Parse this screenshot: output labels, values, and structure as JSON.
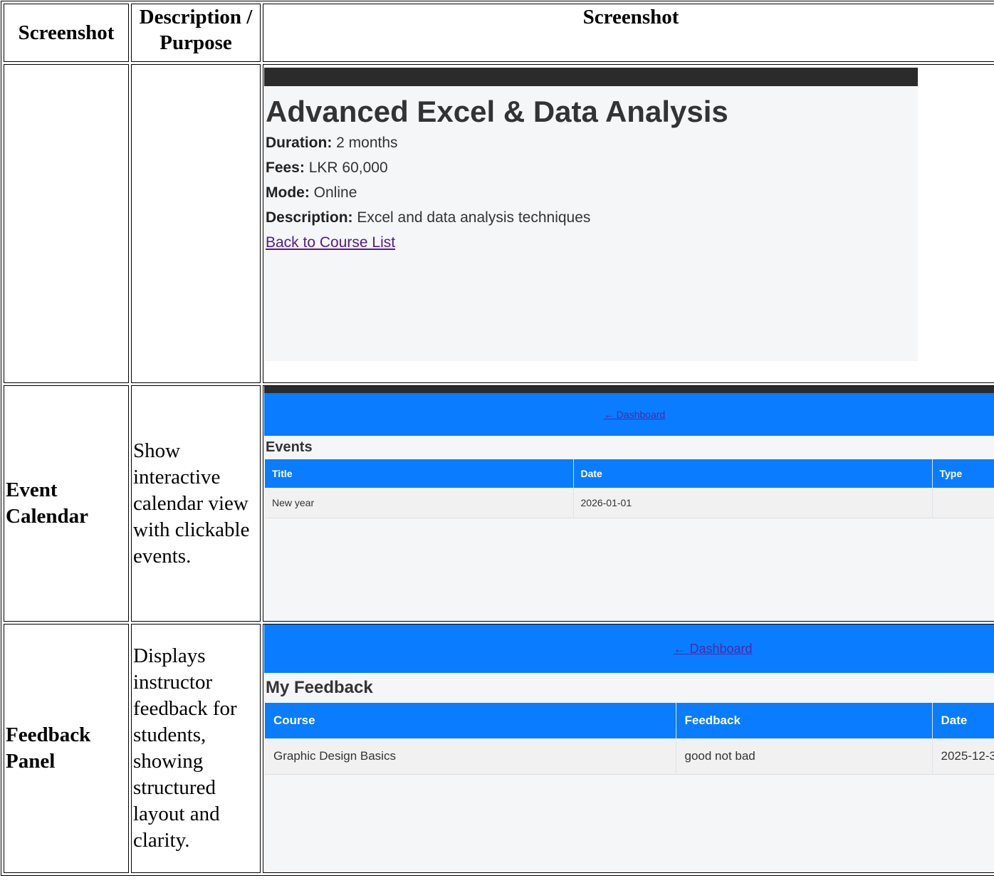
{
  "headers": {
    "col1": "Screenshot",
    "col2": "Description / Purpose",
    "col3": "Screenshot"
  },
  "row1": {
    "label": "",
    "description": "",
    "shot": {
      "title": "Advanced Excel & Data Analysis",
      "duration_label": "Duration:",
      "duration_value": "2 months",
      "fees_label": "Fees:",
      "fees_value": "LKR 60,000",
      "mode_label": "Mode:",
      "mode_value": "Online",
      "description_label": "Description:",
      "description_value": "Excel and data analysis techniques",
      "back_link": "Back to Course List"
    }
  },
  "row2": {
    "label": "Event Calendar",
    "description": "Show interactive calendar view with clickable events.",
    "shot": {
      "nav_link": "← Dashboard",
      "heading": "Events",
      "columns": [
        "Title",
        "Date",
        "Type"
      ],
      "rows": [
        [
          "New year",
          "2026-01-01",
          ""
        ]
      ]
    }
  },
  "row3": {
    "label": "Feedback Panel",
    "description": "Displays instructor feedback for students, showing structured layout and clarity.",
    "shot": {
      "nav_link": "← Dashboard",
      "heading": "My Feedback",
      "columns": [
        "Course",
        "Feedback",
        "Date"
      ],
      "rows": [
        [
          "Graphic Design Basics",
          "good not bad",
          "2025-12-3"
        ]
      ]
    }
  }
}
